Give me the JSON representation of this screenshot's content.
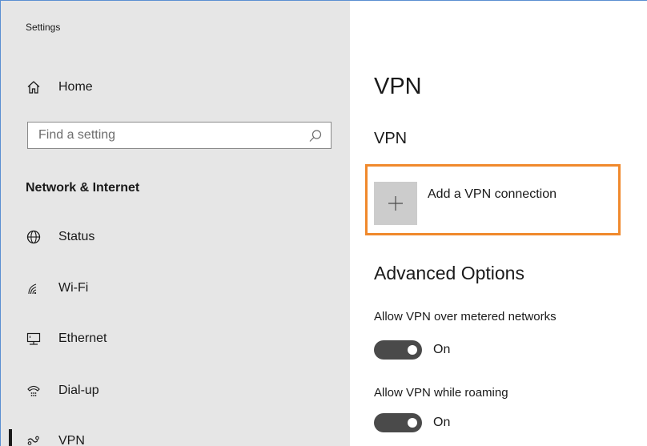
{
  "app": {
    "title": "Settings"
  },
  "sidebar": {
    "home": {
      "label": "Home",
      "icon": "home-icon"
    },
    "search": {
      "placeholder": "Find a setting",
      "value": "",
      "icon": "search-icon"
    },
    "section_heading": "Network & Internet",
    "items": [
      {
        "label": "Status",
        "icon": "globe-icon"
      },
      {
        "label": "Wi-Fi",
        "icon": "wifi-icon"
      },
      {
        "label": "Ethernet",
        "icon": "ethernet-icon"
      },
      {
        "label": "Dial-up",
        "icon": "dialup-icon"
      },
      {
        "label": "VPN",
        "icon": "vpn-icon",
        "selected": true
      }
    ]
  },
  "main": {
    "page_title": "VPN",
    "section_title": "VPN",
    "add_connection": {
      "label": "Add a VPN connection",
      "icon": "plus-icon"
    },
    "advanced": {
      "title": "Advanced Options",
      "settings": [
        {
          "label": "Allow VPN over metered networks",
          "state": "On",
          "on": true
        },
        {
          "label": "Allow VPN while roaming",
          "state": "On",
          "on": true
        }
      ]
    }
  },
  "colors": {
    "sidebar_bg": "#e6e6e6",
    "highlight_frame": "#f0892c",
    "toggle_on": "#4a4a4a",
    "window_border": "#5b8fd1"
  }
}
